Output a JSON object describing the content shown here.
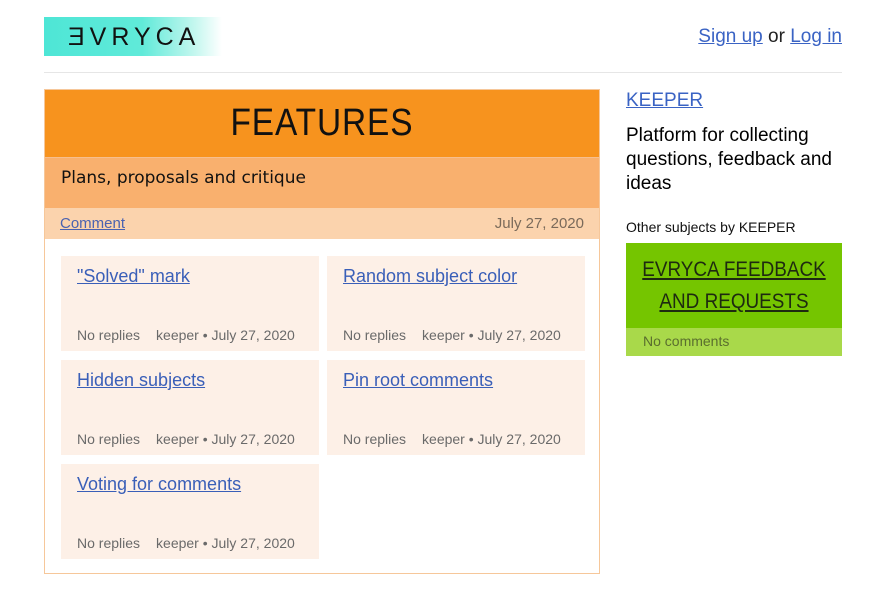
{
  "header": {
    "logo_text": "ƎVRYCA",
    "signup_label": "Sign up",
    "or_text": "or",
    "login_label": "Log in"
  },
  "subject": {
    "title": "FEATURES",
    "description": "Plans, proposals and critique",
    "comment_link": "Comment",
    "date": "July 27, 2020",
    "color": "#f7931e"
  },
  "comments": [
    {
      "title": "\"Solved\" mark",
      "replies": "No replies",
      "byline": "keeper • July 27, 2020"
    },
    {
      "title": "Random subject color",
      "replies": "No replies",
      "byline": "keeper • July 27, 2020"
    },
    {
      "title": "Hidden subjects",
      "replies": "No replies",
      "byline": "keeper • July 27, 2020"
    },
    {
      "title": "Pin root comments",
      "replies": "No replies",
      "byline": "keeper • July 27, 2020"
    },
    {
      "title": "Voting for comments",
      "replies": "No replies",
      "byline": "keeper • July 27, 2020"
    }
  ],
  "sidebar": {
    "owner": "KEEPER",
    "owner_description": "Platform for collecting questions, feedback and ideas",
    "other_label": "Other subjects by KEEPER",
    "other_subject": {
      "title": "EVRYCA FEEDBACK AND REQUESTS",
      "comments": "No comments",
      "color": "#75c500"
    }
  }
}
